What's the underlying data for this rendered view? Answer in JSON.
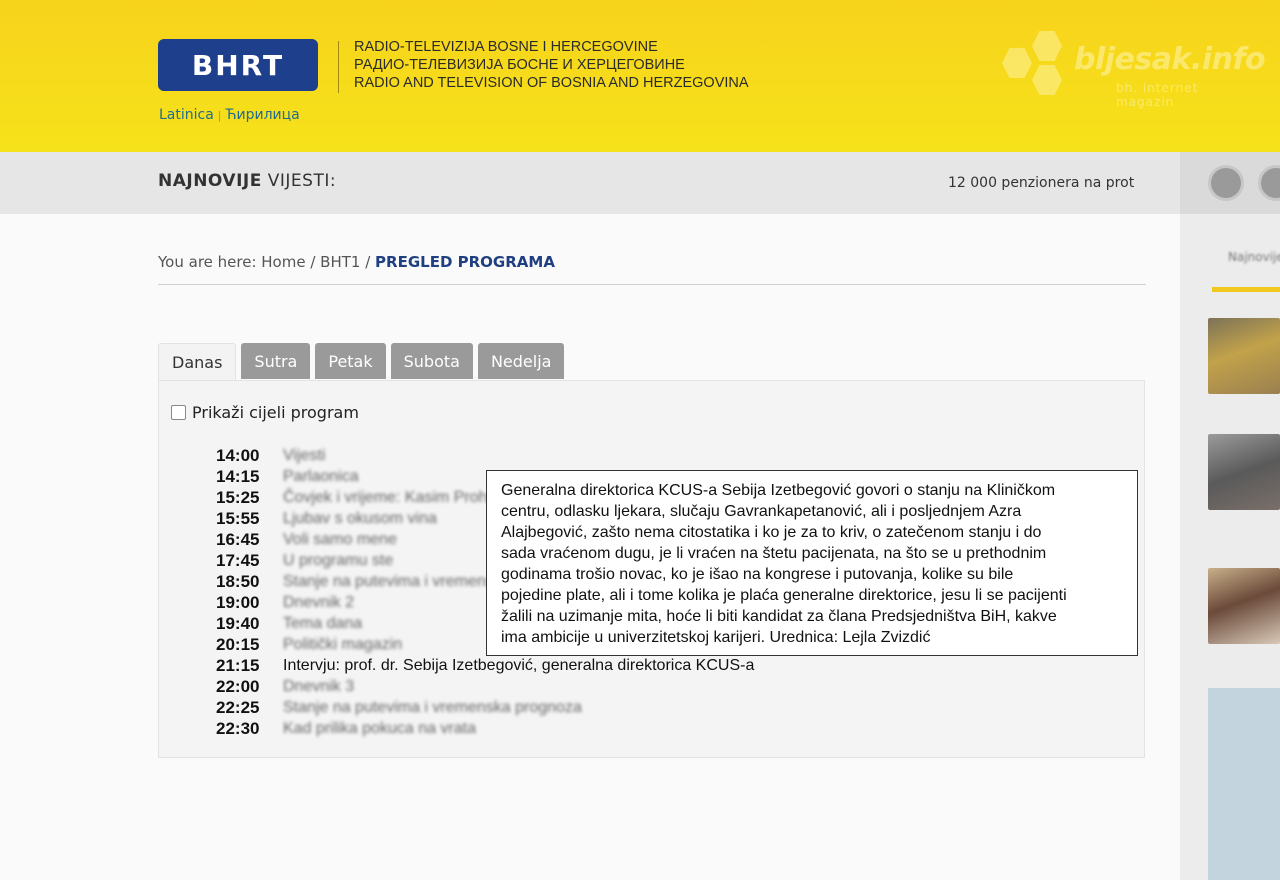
{
  "header": {
    "logo_text": "BHRT",
    "org_lines": [
      "RADIO-TELEVIZIJA BOSNE I HERCEGOVINE",
      "РАДИО-ТЕЛЕВИЗИЈА БОСНЕ И ХЕРЦЕГОВИНЕ",
      "RADIO AND TELEVISION OF BOSNIA  AND HERZEGOVINA"
    ],
    "lang_latin": "Latinica",
    "lang_separator": "|",
    "lang_cyrillic": "Ћирилица",
    "watermark_title": "bljesak.info",
    "watermark_sub": "bh. internet magazin"
  },
  "news": {
    "label_bold": "NAJNOVIJE",
    "label_rest": " VIJESTI:",
    "ticker": "12 000 penzionera na prot"
  },
  "breadcrumb": {
    "prefix": "You are here: ",
    "home": "Home",
    "sep1": " / ",
    "section": "BHT1",
    "sep2": " / ",
    "current": "PREGLED PROGRAMA"
  },
  "tabs": [
    {
      "label": "Danas",
      "active": true
    },
    {
      "label": "Sutra",
      "active": false
    },
    {
      "label": "Petak",
      "active": false
    },
    {
      "label": "Subota",
      "active": false
    },
    {
      "label": "Nedelja",
      "active": false
    }
  ],
  "show_all_label": "Prikaži cijeli program",
  "schedule": [
    {
      "time": "14:00",
      "title": "Vijesti",
      "blurred": true
    },
    {
      "time": "14:15",
      "title": "Parlaonica",
      "blurred": true
    },
    {
      "time": "15:25",
      "title": "Čovjek i vrijeme: Kasim Prohić",
      "blurred": true
    },
    {
      "time": "15:55",
      "title": "Ljubav s okusom vina",
      "blurred": true
    },
    {
      "time": "16:45",
      "title": "Voli samo mene",
      "blurred": true
    },
    {
      "time": "17:45",
      "title": "U programu ste",
      "blurred": true
    },
    {
      "time": "18:50",
      "title": "Stanje na putevima i vremenska prognoza",
      "blurred": true
    },
    {
      "time": "19:00",
      "title": "Dnevnik 2",
      "blurred": true
    },
    {
      "time": "19:40",
      "title": "Tema dana",
      "blurred": true
    },
    {
      "time": "20:15",
      "title": "Politički magazin",
      "blurred": true
    },
    {
      "time": "21:15",
      "title": "Intervju: prof. dr. Sebija Izetbegović, generalna direktorica KCUS-a",
      "blurred": false
    },
    {
      "time": "22:00",
      "title": "Dnevnik 3",
      "blurred": true
    },
    {
      "time": "22:25",
      "title": "Stanje na putevima i vremenska prognoza",
      "blurred": true
    },
    {
      "time": "22:30",
      "title": "Kad prilika pokuca na vrata",
      "blurred": true
    }
  ],
  "tooltip_lines": [
    "Generalna direktorica KCUS-a Sebija Izetbegović govori o stanju na Kliničkom",
    "centru, odlasku ljekara, slučaju Gavrankapetanović, ali i posljednjem Azra",
    "Alajbegović, zašto nema citostatika i ko je za to kriv, o zatečenom stanju i do",
    "sada vraćenom dugu, je li vraćen na štetu pacijenata, na što se u prethodnim",
    "godinama trošio novac, ko je išao na kongrese i putovanja, kolike su bile",
    "pojedine plate, ali i tome kolika je plaća generalne direktorice, jesu li se pacijenti",
    "žalili na uzimanje mita, hoće li biti kandidat za člana Predsjedništva BiH, kakve",
    "ima ambicije u univerzitetskoj karijeri. Urednica: Lejla Zvizdić"
  ],
  "colors": {
    "header_yellow": "#f7d31c",
    "logo_blue": "#1d3f8c",
    "link_blue": "#1f6c8f",
    "breadcrumb_current": "#1f3f80",
    "tab_inactive": "#9a9a9a"
  }
}
